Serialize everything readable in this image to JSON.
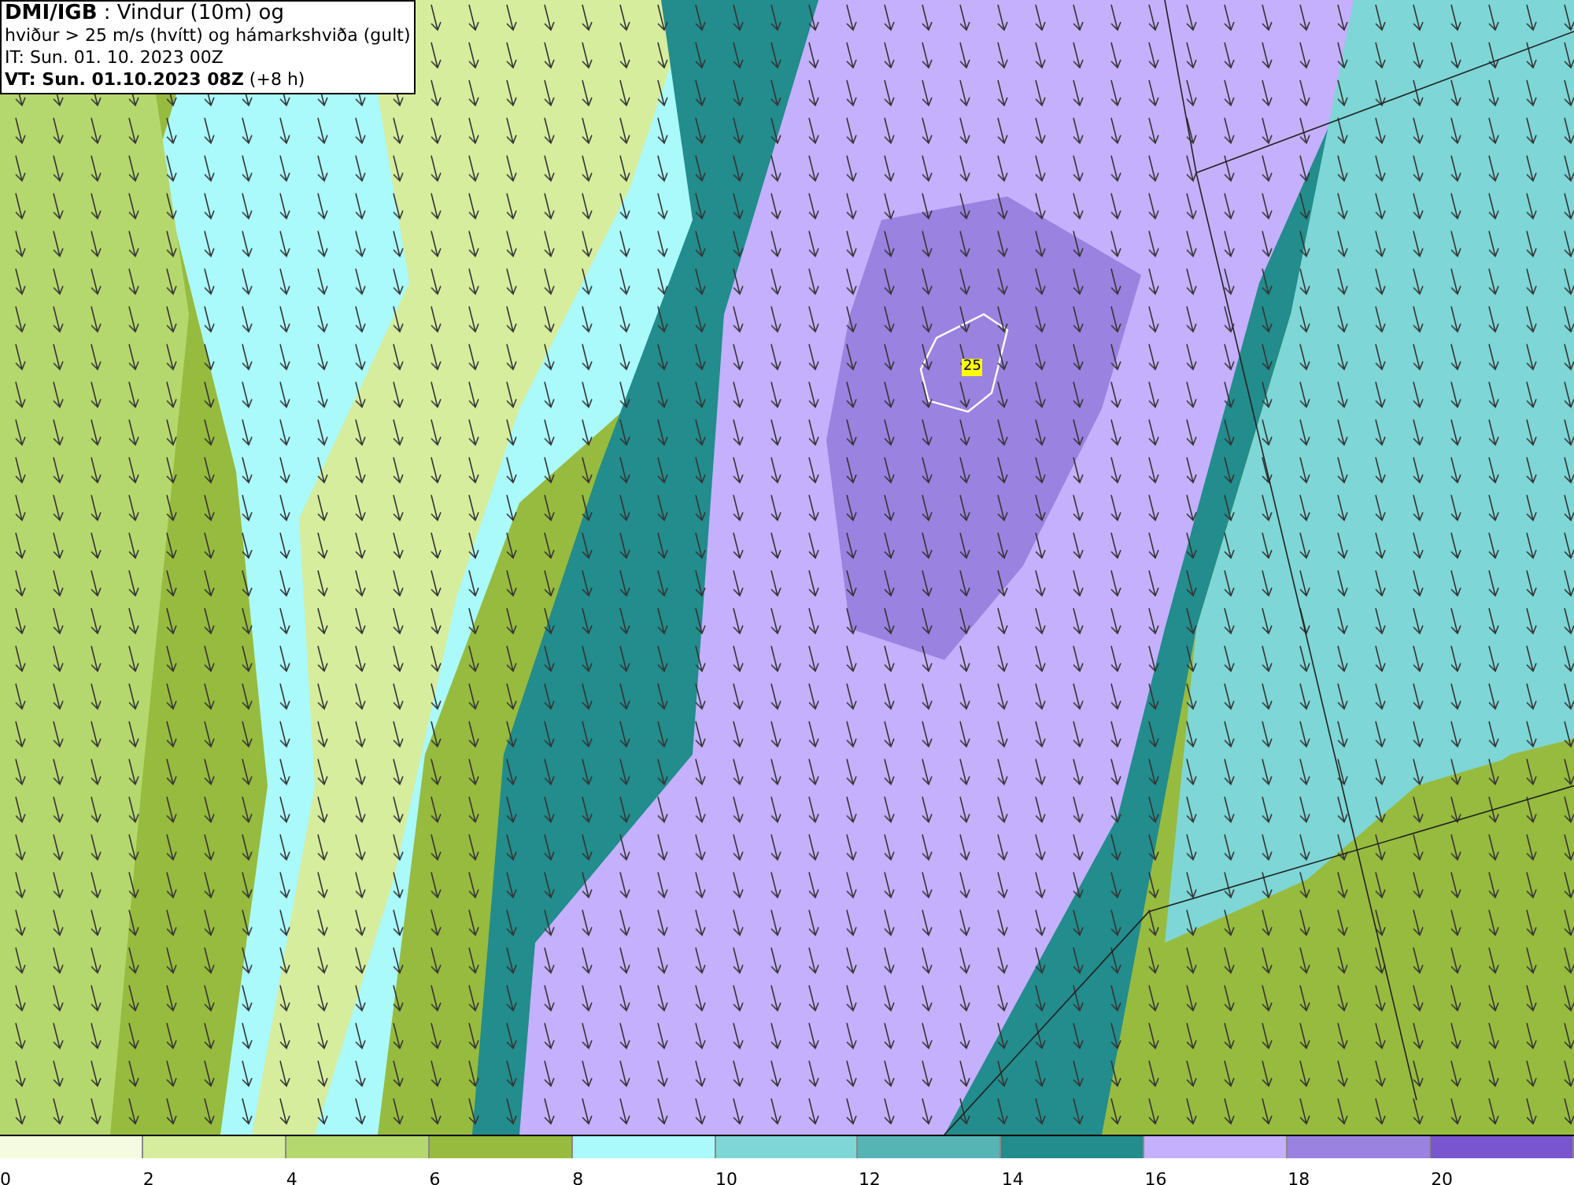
{
  "header": {
    "lines": [
      "**DMI/IGB** : Vindur (10m) og",
      "hviður > 25 m/s (hvítt) og hámarkshviða (gult)",
      "IT: Sun. 01. 10. 2023 00Z",
      "**VT: Sun. 01.10.2023 08Z** (+8 h)"
    ]
  },
  "map": {
    "marker": "25"
  },
  "legend": [
    {
      "label": "0",
      "color": "#f5fbe0"
    },
    {
      "label": "2",
      "color": "#d6ed9e"
    },
    {
      "label": "4",
      "color": "#b5d86e"
    },
    {
      "label": "6",
      "color": "#97bb3e"
    },
    {
      "label": "8",
      "color": "#aaf9fb"
    },
    {
      "label": "10",
      "color": "#7ed6d6"
    },
    {
      "label": "12",
      "color": "#56b4b4"
    },
    {
      "label": "14",
      "color": "#238c8c"
    },
    {
      "label": "16",
      "color": "#c4b0fc"
    },
    {
      "label": "18",
      "color": "#9a82e0"
    },
    {
      "label": "20",
      "color": "#7a55d0"
    }
  ]
}
